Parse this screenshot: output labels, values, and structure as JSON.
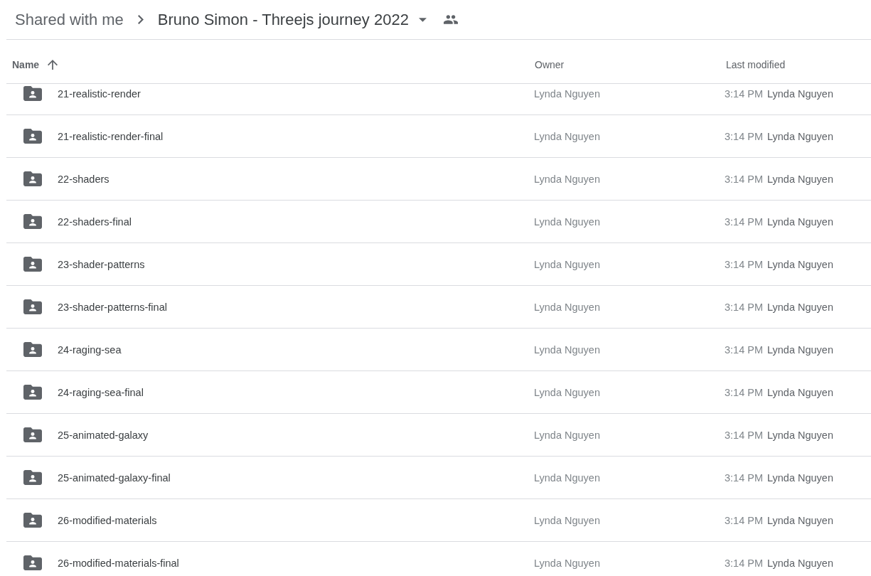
{
  "breadcrumb": [
    {
      "label": "Shared with me",
      "current": false
    },
    {
      "label": "Bruno Simon - Threejs journey 2022",
      "current": true
    }
  ],
  "columns": [
    {
      "label": "Name",
      "sorted": true
    },
    {
      "label": "Owner",
      "sorted": false
    },
    {
      "label": "Last modified",
      "sorted": false
    }
  ],
  "rows": [
    {
      "name": "21-realistic-render",
      "owner": "Lynda Nguyen",
      "modified_time": "3:14 PM",
      "modified_by": "Lynda Nguyen"
    },
    {
      "name": "21-realistic-render-final",
      "owner": "Lynda Nguyen",
      "modified_time": "3:14 PM",
      "modified_by": "Lynda Nguyen"
    },
    {
      "name": "22-shaders",
      "owner": "Lynda Nguyen",
      "modified_time": "3:14 PM",
      "modified_by": "Lynda Nguyen"
    },
    {
      "name": "22-shaders-final",
      "owner": "Lynda Nguyen",
      "modified_time": "3:14 PM",
      "modified_by": "Lynda Nguyen"
    },
    {
      "name": "23-shader-patterns",
      "owner": "Lynda Nguyen",
      "modified_time": "3:14 PM",
      "modified_by": "Lynda Nguyen"
    },
    {
      "name": "23-shader-patterns-final",
      "owner": "Lynda Nguyen",
      "modified_time": "3:14 PM",
      "modified_by": "Lynda Nguyen"
    },
    {
      "name": "24-raging-sea",
      "owner": "Lynda Nguyen",
      "modified_time": "3:14 PM",
      "modified_by": "Lynda Nguyen"
    },
    {
      "name": "24-raging-sea-final",
      "owner": "Lynda Nguyen",
      "modified_time": "3:14 PM",
      "modified_by": "Lynda Nguyen"
    },
    {
      "name": "25-animated-galaxy",
      "owner": "Lynda Nguyen",
      "modified_time": "3:14 PM",
      "modified_by": "Lynda Nguyen"
    },
    {
      "name": "25-animated-galaxy-final",
      "owner": "Lynda Nguyen",
      "modified_time": "3:14 PM",
      "modified_by": "Lynda Nguyen"
    },
    {
      "name": "26-modified-materials",
      "owner": "Lynda Nguyen",
      "modified_time": "3:14 PM",
      "modified_by": "Lynda Nguyen"
    },
    {
      "name": "26-modified-materials-final",
      "owner": "Lynda Nguyen",
      "modified_time": "3:14 PM",
      "modified_by": "Lynda Nguyen"
    }
  ]
}
